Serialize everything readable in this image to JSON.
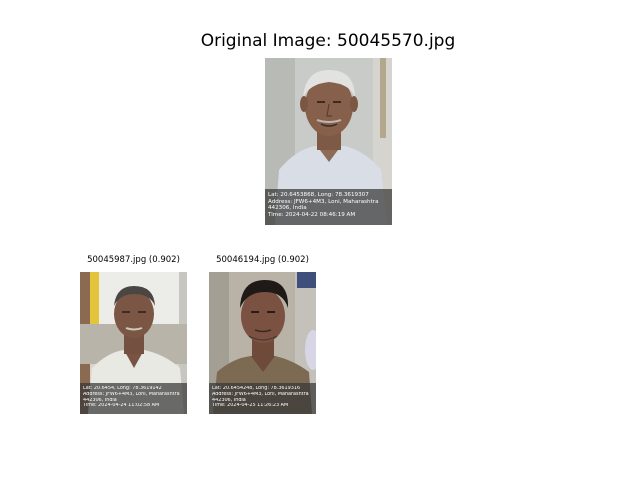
{
  "query": {
    "title": "Original Image: 50045570.jpg",
    "overlay": {
      "line1": "Lat: 20.6453868, Long: 78.3619307",
      "line2": "Address: JFW6+4M3, Loni, Maharashtra",
      "line3": "442306, India",
      "line4": "Time: 2024-04-22 08:46:19 AM"
    }
  },
  "matches": [
    {
      "caption": "50045987.jpg (0.902)",
      "overlay": {
        "line1": "Lat: 20.6454, Long: 78.3619142",
        "line2": "Address: JFW6+4M3, Loni, Maharashtra",
        "line3": "442306, India",
        "line4": "Time: 2024-04-24 11:02:58 AM"
      }
    },
    {
      "caption": "50046194.jpg (0.902)",
      "overlay": {
        "line1": "Lat: 20.6454248, Long: 78.3619316",
        "line2": "Address: JFW6+4M3, Loni, Maharashtra",
        "line3": "442306, India",
        "line4": "Time: 2024-04-25 11:26:23 AM"
      }
    }
  ]
}
